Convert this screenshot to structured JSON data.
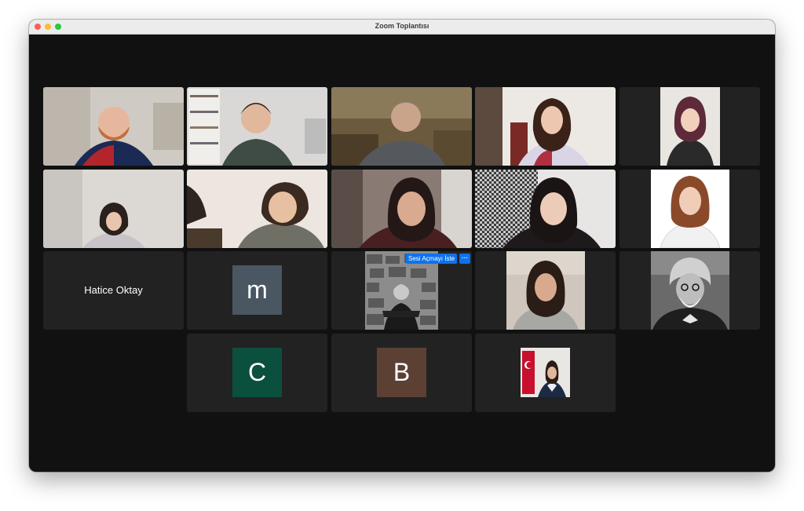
{
  "window": {
    "title": "Zoom Toplantısı"
  },
  "participants": [
    {
      "kind": "video",
      "active": false
    },
    {
      "kind": "video",
      "active": true
    },
    {
      "kind": "video",
      "active": false
    },
    {
      "kind": "video",
      "active": false
    },
    {
      "kind": "video",
      "active": false
    },
    {
      "kind": "video",
      "active": false
    },
    {
      "kind": "video",
      "active": false
    },
    {
      "kind": "video",
      "active": false
    },
    {
      "kind": "video",
      "active": false
    },
    {
      "kind": "video",
      "active": false
    },
    {
      "kind": "name",
      "name": "Hatice Oktay"
    },
    {
      "kind": "avatar",
      "letter": "m",
      "color": "#4a5661"
    },
    {
      "kind": "video",
      "active": false
    },
    {
      "kind": "video",
      "active": false
    },
    {
      "kind": "video",
      "active": false
    },
    {
      "kind": "avatar",
      "letter": "C",
      "color": "#0b4f3e"
    },
    {
      "kind": "avatar",
      "letter": "B",
      "color": "#5c4034"
    },
    {
      "kind": "video",
      "active": false
    }
  ],
  "hover_controls": {
    "unmute_label": "Sesi Açmayı İste",
    "more_label": "···",
    "accent": "#0e72ed"
  },
  "colors": {
    "active_speaker": "#2ecc40",
    "meeting_bg": "#111111",
    "tile_bg": "#222222"
  }
}
